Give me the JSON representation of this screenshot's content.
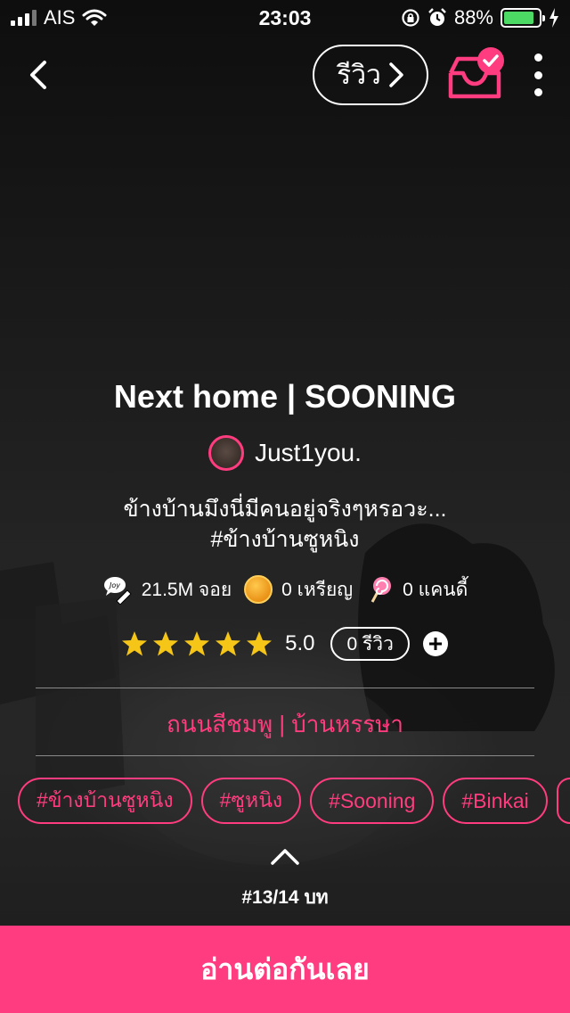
{
  "status_bar": {
    "carrier": "AIS",
    "time": "23:03",
    "battery": "88%",
    "battery_level": 0.88
  },
  "nav": {
    "review_label": "รีวิว",
    "icons": [
      "back-chevron",
      "chevron-right",
      "inbox-check",
      "more-vertical"
    ]
  },
  "story": {
    "title": "Next home | SOONING",
    "author": "Just1you.",
    "description_line1": "ข้างบ้านมึงนี่มีคนอยู่จริงๆหรอวะ...",
    "description_line2": "#ข้างบ้านซูหนิง",
    "stats": {
      "joy": "21.5M จอย",
      "coins": "0 เหรียญ",
      "candy": "0 แคนดี้"
    },
    "rating": "5.0",
    "rating_stars": 5,
    "review_count": "0 รีวิว",
    "category": "ถนนสีชมพู | บ้านหรรษา",
    "tags": [
      "#ข้างบ้านซูหนิง",
      "#ซูหนิง",
      "#Sooning",
      "#Binkai"
    ],
    "chapter": "#13/14 บท"
  },
  "read_button": "อ่านต่อกันเลย",
  "colors": {
    "accent": "#ff3c7f",
    "star": "#f5c518",
    "battery": "#4cd964"
  }
}
